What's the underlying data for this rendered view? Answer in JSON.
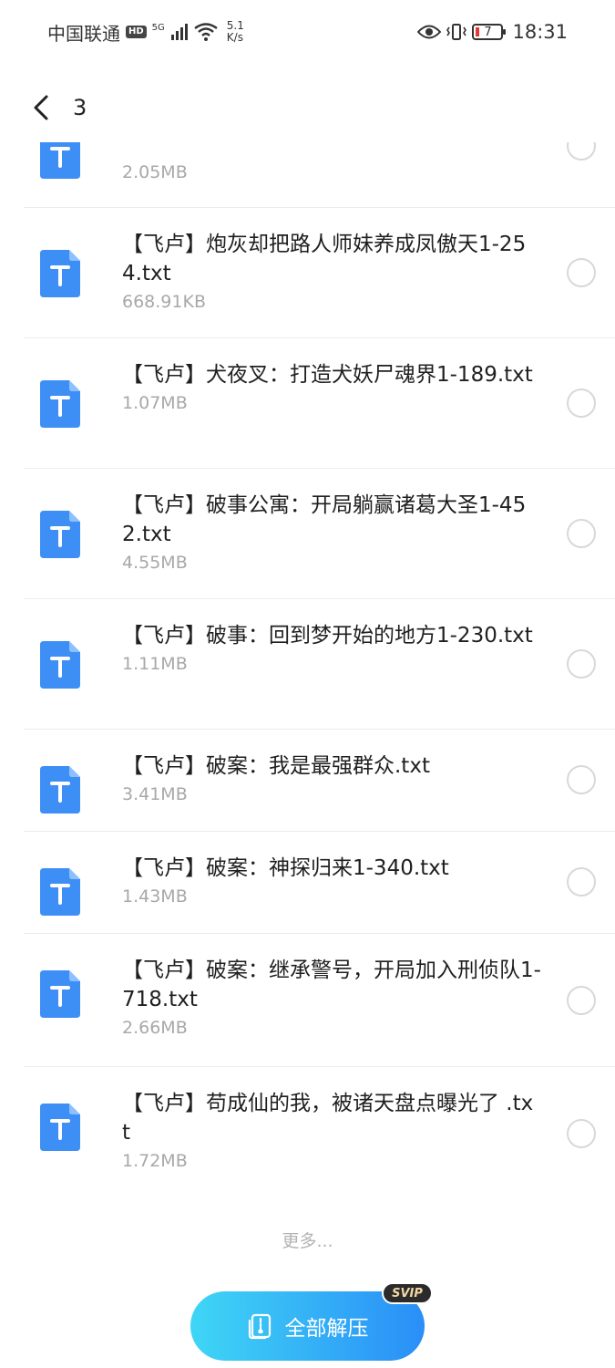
{
  "status_bar": {
    "carrier": "中国联通",
    "hd": "HD",
    "network": "5G",
    "speed_value": "5.1",
    "speed_unit": "K/s",
    "battery": "7",
    "time": "18:31"
  },
  "header": {
    "title": "3"
  },
  "files": [
    {
      "name": "",
      "size": "2.05MB"
    },
    {
      "name": "【飞卢】炮灰却把路人师妹养成凤傲天1-254.txt",
      "size": "668.91KB"
    },
    {
      "name": "【飞卢】犬夜叉：打造犬妖尸魂界1-189.txt",
      "size": "1.07MB"
    },
    {
      "name": "【飞卢】破事公寓：开局躺赢诸葛大圣1-452.txt",
      "size": "4.55MB"
    },
    {
      "name": "【飞卢】破事：回到梦开始的地方1-230.txt",
      "size": "1.11MB"
    },
    {
      "name": "【飞卢】破案：我是最强群众.txt",
      "size": "3.41MB"
    },
    {
      "name": "【飞卢】破案：神探归来1-340.txt",
      "size": "1.43MB"
    },
    {
      "name": "【飞卢】破案：继承警号，开局加入刑侦队1-718.txt",
      "size": "2.66MB"
    },
    {
      "name": "【飞卢】苟成仙的我，被诸天盘点曝光了 .txt",
      "size": "1.72MB"
    }
  ],
  "more_label": "更多...",
  "extract_button": {
    "label": "全部解压",
    "badge": "SVIP"
  },
  "colors": {
    "accent_start": "#3fd6f6",
    "accent_end": "#2a8ef7",
    "icon_blue": "#3d8ef5"
  }
}
